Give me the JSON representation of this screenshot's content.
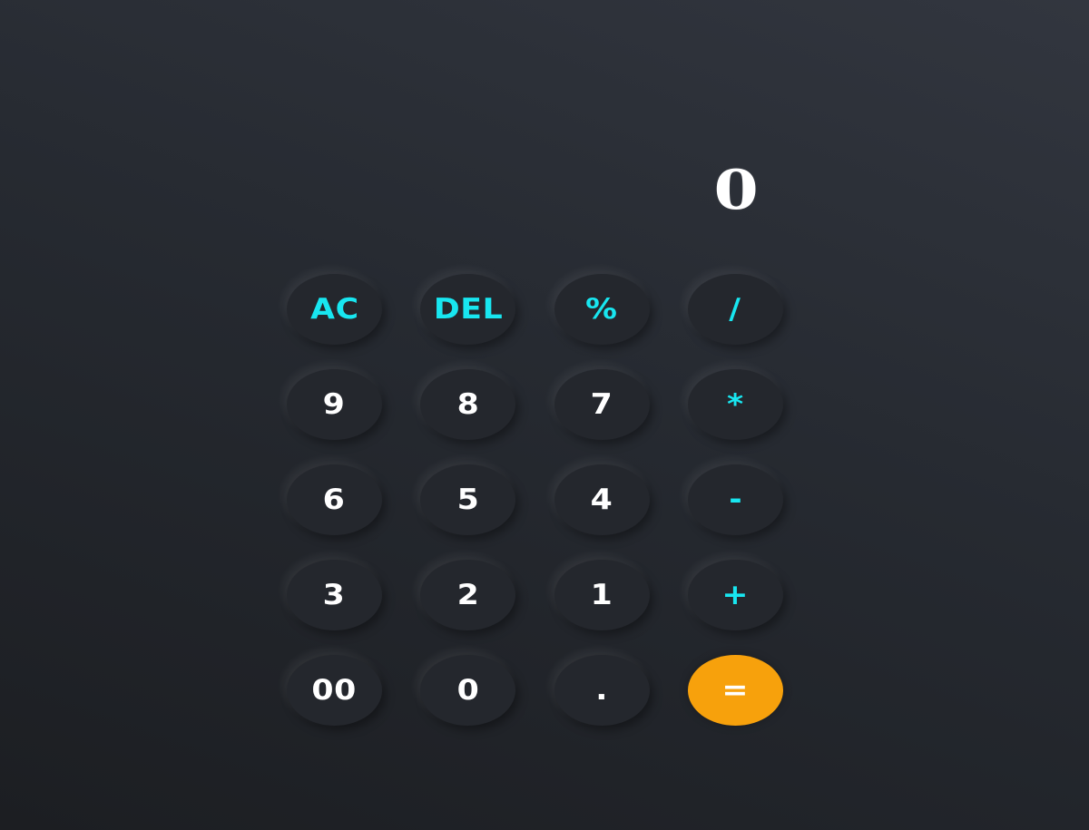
{
  "display": {
    "value": "0"
  },
  "keys": [
    {
      "label": "AC",
      "name": "clear-button",
      "kind": "op"
    },
    {
      "label": "DEL",
      "name": "delete-button",
      "kind": "op"
    },
    {
      "label": "%",
      "name": "percent-button",
      "kind": "op"
    },
    {
      "label": "/",
      "name": "divide-button",
      "kind": "op"
    },
    {
      "label": "9",
      "name": "digit-9-button",
      "kind": "digit"
    },
    {
      "label": "8",
      "name": "digit-8-button",
      "kind": "digit"
    },
    {
      "label": "7",
      "name": "digit-7-button",
      "kind": "digit"
    },
    {
      "label": "*",
      "name": "multiply-button",
      "kind": "op"
    },
    {
      "label": "6",
      "name": "digit-6-button",
      "kind": "digit"
    },
    {
      "label": "5",
      "name": "digit-5-button",
      "kind": "digit"
    },
    {
      "label": "4",
      "name": "digit-4-button",
      "kind": "digit"
    },
    {
      "label": "-",
      "name": "subtract-button",
      "kind": "op"
    },
    {
      "label": "3",
      "name": "digit-3-button",
      "kind": "digit"
    },
    {
      "label": "2",
      "name": "digit-2-button",
      "kind": "digit"
    },
    {
      "label": "1",
      "name": "digit-1-button",
      "kind": "digit"
    },
    {
      "label": "+",
      "name": "add-button",
      "kind": "op"
    },
    {
      "label": "00",
      "name": "double-zero-button",
      "kind": "digit"
    },
    {
      "label": "0",
      "name": "digit-0-button",
      "kind": "digit"
    },
    {
      "label": ".",
      "name": "decimal-button",
      "kind": "digit"
    },
    {
      "label": "=",
      "name": "equals-button",
      "kind": "equals"
    }
  ],
  "colors": {
    "operator_text": "#18e6f0",
    "digit_text": "#ffffff",
    "equals_background": "#f7a10c",
    "key_background": "#24272d"
  }
}
